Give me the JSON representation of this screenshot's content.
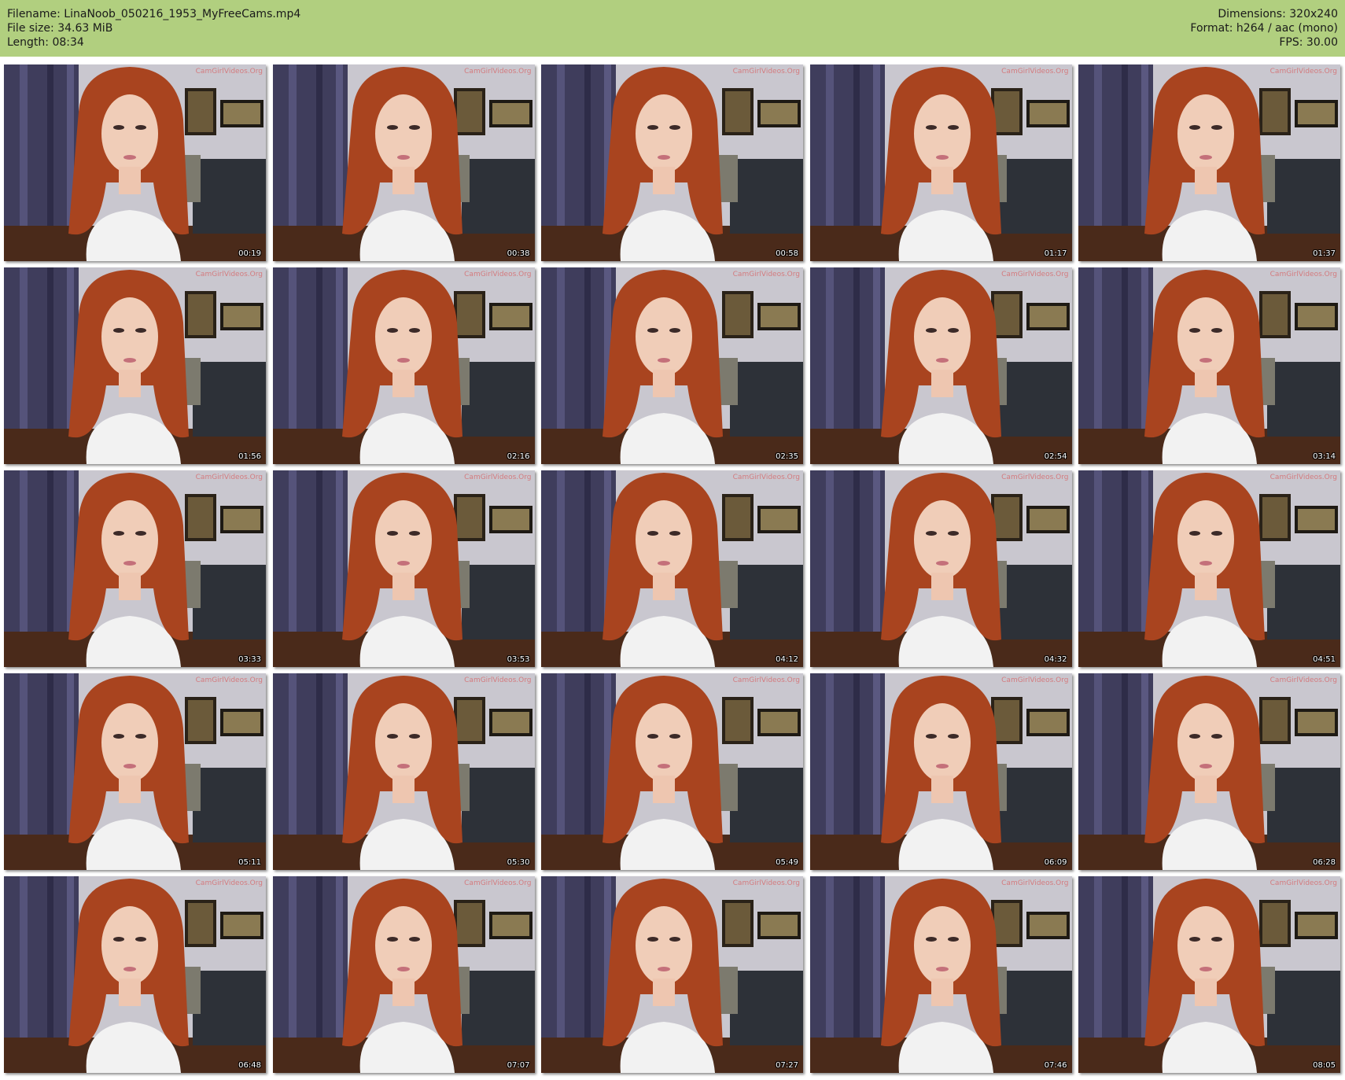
{
  "header": {
    "filename": "Filename: LinaNoob_050216_1953_MyFreeCams.mp4",
    "filesize": "File size: 34.63 MiB",
    "length": "Length: 08:34",
    "dimensions": "Dimensions: 320x240",
    "format": "Format: h264 / aac (mono)",
    "fps": "FPS: 30.00"
  },
  "colors": {
    "header_bg": "#b1cf7f",
    "hair": "#a9441f",
    "wall": "#c9c7cf",
    "curtain": "#3f3d5c",
    "floor": "#4a2a1a",
    "shirt": "#f2f2f2"
  },
  "watermark": "CamGirlVideos.Org",
  "thumbnails": [
    {
      "time": "00:19"
    },
    {
      "time": "00:38"
    },
    {
      "time": "00:58"
    },
    {
      "time": "01:17"
    },
    {
      "time": "01:37"
    },
    {
      "time": "01:56"
    },
    {
      "time": "02:16"
    },
    {
      "time": "02:35"
    },
    {
      "time": "02:54"
    },
    {
      "time": "03:14"
    },
    {
      "time": "03:33"
    },
    {
      "time": "03:53"
    },
    {
      "time": "04:12"
    },
    {
      "time": "04:32"
    },
    {
      "time": "04:51"
    },
    {
      "time": "05:11"
    },
    {
      "time": "05:30"
    },
    {
      "time": "05:49"
    },
    {
      "time": "06:09"
    },
    {
      "time": "06:28"
    },
    {
      "time": "06:48"
    },
    {
      "time": "07:07"
    },
    {
      "time": "07:27"
    },
    {
      "time": "07:46"
    },
    {
      "time": "08:05"
    }
  ]
}
